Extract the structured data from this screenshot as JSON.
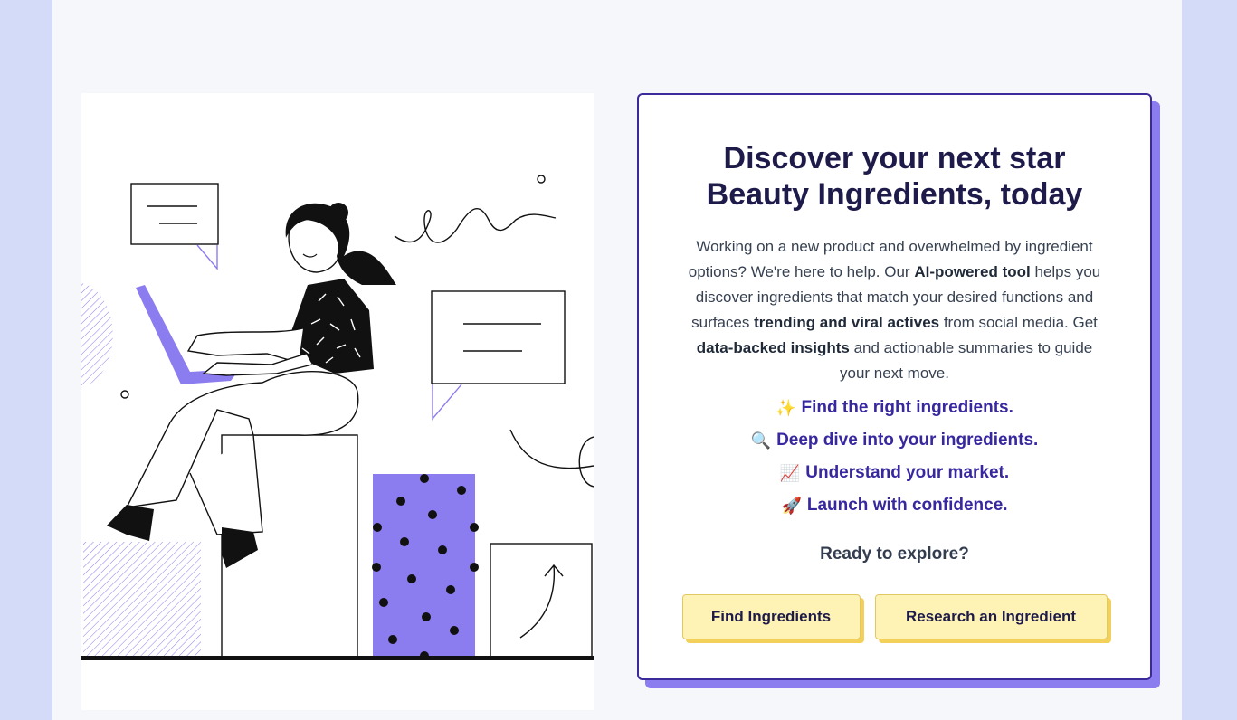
{
  "hero": {
    "title_line1": "Discover your next star",
    "title_line2": "Beauty Ingredients, today",
    "intro": {
      "t1": "Working on a new product and overwhelmed by ingredient options? We're here to help. Our ",
      "b1": "AI-powered tool",
      "t2": " helps you discover ingredients that match your desired functions and surfaces ",
      "b2": "trending and viral actives",
      "t3": " from social media. Get ",
      "b3": "data-backed insights",
      "t4": " and actionable summaries to guide your next move."
    },
    "features": [
      {
        "icon": "sparkles-icon",
        "emoji": "✨",
        "text": "Find the right ingredients."
      },
      {
        "icon": "magnifier-icon",
        "emoji": "🔍",
        "text": "Deep dive into your ingredients."
      },
      {
        "icon": "chart-up-icon",
        "emoji": "📈",
        "text": "Understand your market."
      },
      {
        "icon": "rocket-icon",
        "emoji": "🚀",
        "text": "Launch with confidence."
      }
    ],
    "cta_label": "Ready to explore?",
    "buttons": {
      "find": "Find Ingredients",
      "research": "Research an Ingredient"
    }
  },
  "colors": {
    "background": "#d4dbf9",
    "accent": "#8b7cf0",
    "title": "#1e1b4b",
    "feature_text": "#3728a0",
    "button_fill": "#fef3b4"
  }
}
